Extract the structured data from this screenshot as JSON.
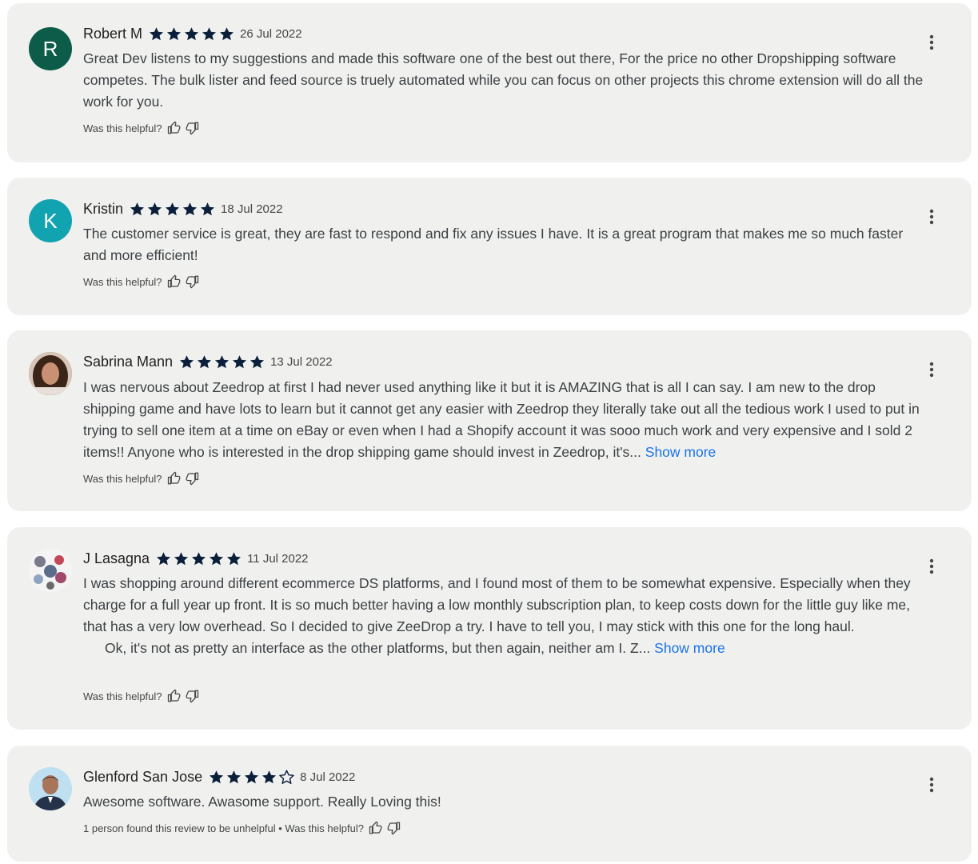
{
  "colors": {
    "card_bg": "#f0f1ef",
    "star": "#0b1f3a",
    "link": "#1a73e8",
    "avatar_r": "#0d5c4a",
    "avatar_k": "#12a3b1"
  },
  "reviews": [
    {
      "avatar_initial": "R",
      "name": "Robert M",
      "rating": 5,
      "date": "26 Jul 2022",
      "text": "Great Dev listens to my suggestions and made this software one of the best out there, For the price no other Dropshipping software competes. The bulk lister and feed source is truely automated while you can focus on other projects this chrome extension will do all the work for you.",
      "helpful_label": "Was this helpful?"
    },
    {
      "avatar_initial": "K",
      "name": "Kristin",
      "rating": 5,
      "date": "18 Jul 2022",
      "text": "The customer service is great, they are fast to respond and fix any issues I have.  It is a great program that makes me so much faster and more efficient!",
      "helpful_label": "Was this helpful?"
    },
    {
      "name": "Sabrina Mann",
      "rating": 5,
      "date": "13 Jul 2022",
      "text": "I was nervous about Zeedrop at first I had never used anything like it but it is AMAZING that is all I can say. I am new to the drop shipping game and have lots to learn but it cannot get any easier with Zeedrop they literally take out all the tedious work I used to put in trying to sell one item at a time on eBay or even when I had a Shopify account it was sooo much work and very expensive and I sold 2 items!!  Anyone who is interested in the drop shipping game should invest in Zeedrop, it's...",
      "show_more": "Show more",
      "helpful_label": "Was this helpful?"
    },
    {
      "name": "J Lasagna",
      "rating": 5,
      "date": "11 Jul 2022",
      "text": "I was shopping around different ecommerce DS platforms, and I found most of them to be somewhat expensive. Especially when they charge for a full year up front. It is so much better having a low monthly subscription plan, to keep costs down for the little guy like me, that has a very low overhead. So I decided to give ZeeDrop a try. I have to tell you, I may stick with this one for the long haul.",
      "text2": "Ok, it's not as pretty an interface as the other platforms, but then again, neither am I. Z...",
      "show_more": "Show more",
      "helpful_label": "Was this helpful?"
    },
    {
      "name": "Glenford San Jose",
      "rating": 4,
      "date": "8 Jul 2022",
      "text": "Awesome software. Awasome support. Really Loving this!",
      "helpful_label": "1 person found this review to be unhelpful • Was this helpful?"
    }
  ]
}
